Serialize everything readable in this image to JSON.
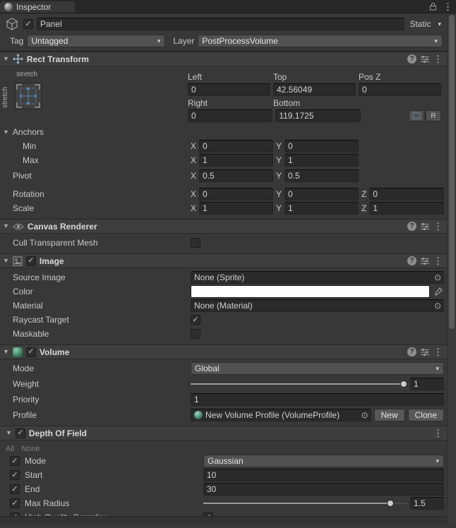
{
  "icons": {
    "foldout": "▼",
    "dropdown_arrow": "▾",
    "check": "✓",
    "picker": "⊙",
    "kebab": "⋮",
    "help": "?",
    "raw_toggle": "R"
  },
  "tab": {
    "title": "Inspector"
  },
  "gameobject": {
    "name": "Panel",
    "static_label": "Static",
    "tag_label": "Tag",
    "tag_value": "Untagged",
    "layer_label": "Layer",
    "layer_value": "PostProcessVolume"
  },
  "axis": {
    "x": "X",
    "y": "Y",
    "z": "Z"
  },
  "rect_transform": {
    "title": "Rect Transform",
    "stretch_h": "stretch",
    "stretch_v": "stretch",
    "left_label": "Left",
    "left_value": "0",
    "top_label": "Top",
    "top_value": "42.56049",
    "posz_label": "Pos Z",
    "posz_value": "0",
    "right_label": "Right",
    "right_value": "0",
    "bottom_label": "Bottom",
    "bottom_value": "119.1725",
    "anchors_label": "Anchors",
    "min_label": "Min",
    "min_x": "0",
    "min_y": "0",
    "max_label": "Max",
    "max_x": "1",
    "max_y": "1",
    "pivot_label": "Pivot",
    "pivot_x": "0.5",
    "pivot_y": "0.5",
    "rotation_label": "Rotation",
    "rotation_x": "0",
    "rotation_y": "0",
    "rotation_z": "0",
    "scale_label": "Scale",
    "scale_x": "1",
    "scale_y": "1",
    "scale_z": "1"
  },
  "canvas_renderer": {
    "title": "Canvas Renderer",
    "cull_label": "Cull Transparent Mesh"
  },
  "image": {
    "title": "Image",
    "source_label": "Source Image",
    "source_value": "None (Sprite)",
    "color_label": "Color",
    "color_value": "#FFFFFF",
    "material_label": "Material",
    "material_value": "None (Material)",
    "raycast_label": "Raycast Target",
    "maskable_label": "Maskable"
  },
  "volume": {
    "title": "Volume",
    "mode_label": "Mode",
    "mode_value": "Global",
    "weight_label": "Weight",
    "weight_value": "1",
    "priority_label": "Priority",
    "priority_value": "1",
    "profile_label": "Profile",
    "profile_value": "New Volume Profile (VolumeProfile)",
    "new_button": "New",
    "clone_button": "Clone"
  },
  "depth_of_field": {
    "title": "Depth Of Field",
    "all_label": "All",
    "none_label": "None",
    "mode_label": "Mode",
    "mode_value": "Gaussian",
    "start_label": "Start",
    "start_value": "10",
    "end_label": "End",
    "end_value": "30",
    "max_radius_label": "Max Radius",
    "max_radius_value": "1.5",
    "hq_label": "High Quality Sampling"
  }
}
